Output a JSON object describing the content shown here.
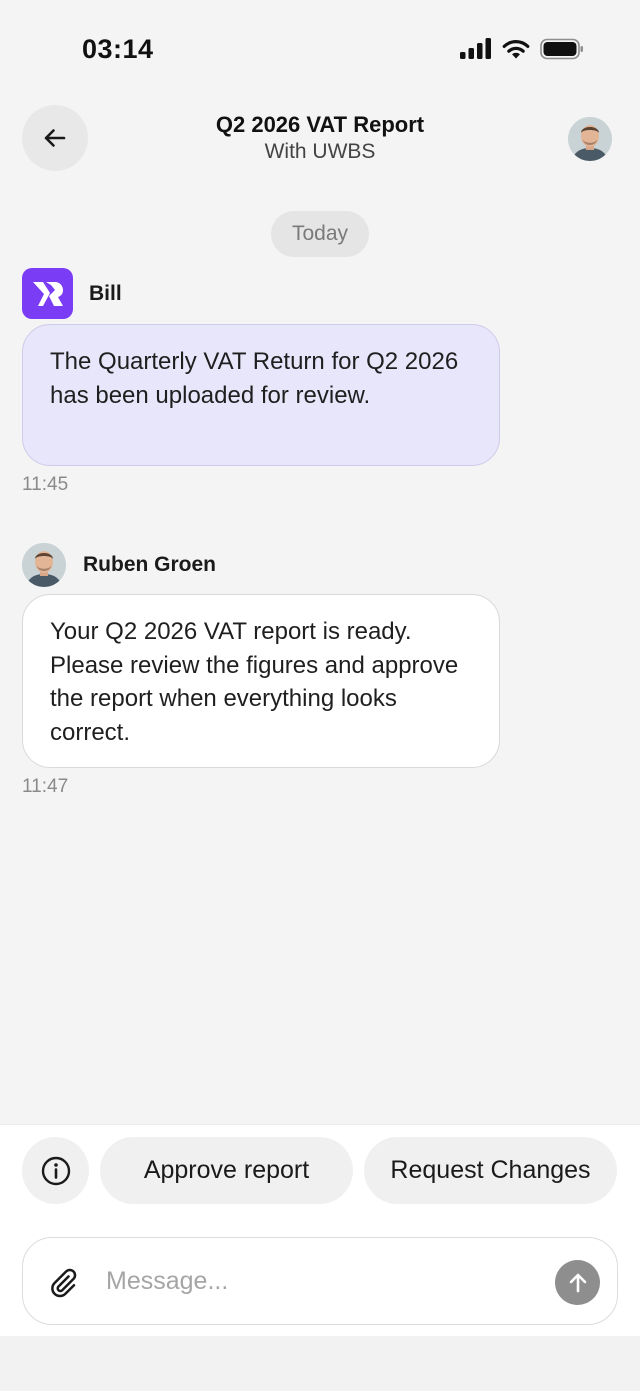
{
  "status_bar": {
    "time": "03:14",
    "icons": [
      "cellular-signal-icon",
      "wifi-icon",
      "battery-icon"
    ]
  },
  "header": {
    "title": "Q2 2026 VAT Report",
    "subtitle": "With UWBS",
    "back_icon": "arrow-left-icon",
    "avatar": "contact-avatar"
  },
  "conversation": {
    "date_label": "Today",
    "messages": [
      {
        "sender": "Bill",
        "sender_avatar": "bill-logo",
        "text": "The Quarterly VAT Return for Q2 2026 has been uploaded for review.",
        "time": "11:45"
      },
      {
        "sender": "Ruben Groen",
        "sender_avatar": "person-avatar",
        "text": "Your Q2 2026 VAT report is ready. Please review the figures and approve the report when everything looks correct.",
        "time": "11:47"
      }
    ]
  },
  "actions": {
    "info_icon": "info-icon",
    "approve_label": "Approve report",
    "request_label": "Request Changes"
  },
  "composer": {
    "placeholder": "Message...",
    "value": "",
    "attach_icon": "paperclip-icon",
    "send_icon": "arrow-up-icon"
  },
  "colors": {
    "background": "#f4f4f4",
    "bill_bubble": "#e8e6fa",
    "bill_brand": "#7a3cf5",
    "send_button": "#8e8e8e"
  }
}
